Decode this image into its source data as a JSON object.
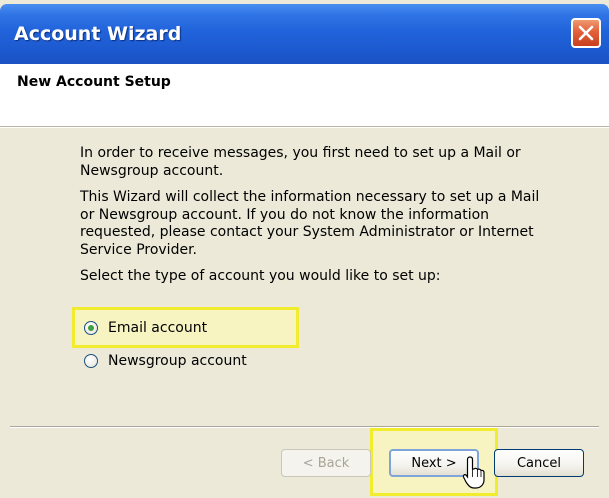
{
  "window": {
    "title": "Account Wizard"
  },
  "header": {
    "title": "New Account Setup"
  },
  "content": {
    "intro": "In order to receive messages, you first need to set up a Mail or Newsgroup account.",
    "info": "This Wizard will collect the information necessary to set up a Mail or Newsgroup account. If you do not know the information requested, please contact your System Administrator or Internet Service Provider.",
    "prompt": "Select the type of account you would like to set up:",
    "options": [
      {
        "label": "Email account",
        "selected": true
      },
      {
        "label": "Newsgroup account",
        "selected": false
      }
    ]
  },
  "buttons": {
    "back": "< Back",
    "next": "Next >",
    "cancel": "Cancel"
  },
  "colors": {
    "titlebar": "#1d5ad0",
    "highlight": "#f2ec2e",
    "dialog_bg": "#ece9d8",
    "close_button": "#e2603a"
  }
}
